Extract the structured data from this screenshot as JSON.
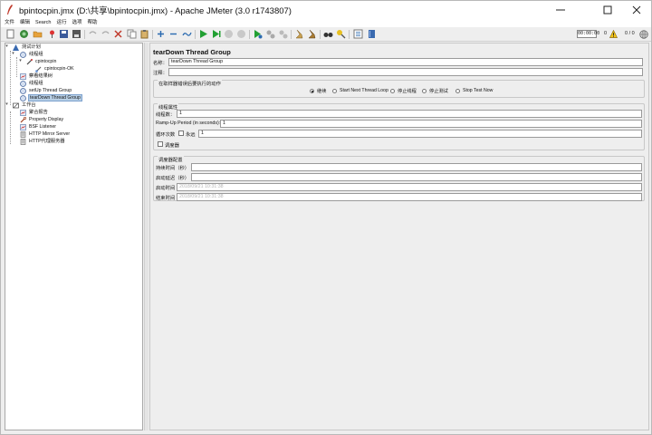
{
  "window": {
    "title": "bpintocpin.jmx (D:\\共享\\bpintocpin.jmx) - Apache JMeter (3.0 r1743807)"
  },
  "menu": [
    "文件",
    "编辑",
    "Search",
    "运行",
    "选项",
    "帮助"
  ],
  "toolbar": {
    "timer": "00:00:00",
    "warnings": "0",
    "threads": "0 / 0"
  },
  "tree": {
    "items": [
      {
        "label": "测试计划",
        "icon": "test-plan-icon"
      },
      {
        "label": "线程组",
        "icon": "thread-group-icon"
      },
      {
        "label": "cpintocpin",
        "icon": "sampler-icon"
      },
      {
        "label": "cpintocpin-OK",
        "icon": "assertion-icon"
      },
      {
        "label": "察看结果树",
        "icon": "listener-icon"
      },
      {
        "label": "线程组",
        "icon": "thread-group-icon"
      },
      {
        "label": "setUp Thread Group",
        "icon": "thread-group-icon"
      },
      {
        "label": "tearDown Thread Group",
        "icon": "thread-group-icon"
      },
      {
        "label": "工作台",
        "icon": "workbench-icon"
      },
      {
        "label": "聚合报告",
        "icon": "listener-icon"
      },
      {
        "label": "Property Display",
        "icon": "wrench-icon"
      },
      {
        "label": "BSF Listener",
        "icon": "listener-icon"
      },
      {
        "label": "HTTP Mirror Server",
        "icon": "server-icon"
      },
      {
        "label": "HTTP代理服务器",
        "icon": "server-icon"
      }
    ]
  },
  "panel": {
    "title": "tearDown Thread Group",
    "name_label": "名称：",
    "name_value": "tearDown Thread Group",
    "comment_label": "注释：",
    "comment_value": "",
    "error_action": {
      "title": "在取样器错误后要执行的动作",
      "options": [
        {
          "label": "继续",
          "selected": true
        },
        {
          "label": "Start Next Thread Loop",
          "selected": false
        },
        {
          "label": "停止线程",
          "selected": false
        },
        {
          "label": "停止测试",
          "selected": false
        },
        {
          "label": "Stop Test Now",
          "selected": false
        }
      ]
    },
    "thread_props": {
      "title": "线程属性",
      "threads_label": "线程数：",
      "threads_value": "1",
      "rampup_label": "Ramp-Up Period (in seconds):",
      "rampup_value": "1",
      "loop_label": "循环次数",
      "forever_label": "永远",
      "loop_value": "1",
      "scheduler_label": "调度器"
    },
    "scheduler": {
      "title": "调度器配置",
      "duration_label": "持续时间（秒）",
      "duration_value": "",
      "delay_label": "启动延迟（秒）",
      "delay_value": "",
      "start_label": "启动时间",
      "start_value": "2018/09/21 10:31:38",
      "end_label": "结束时间",
      "end_value": "2018/09/21 10:31:38"
    }
  }
}
